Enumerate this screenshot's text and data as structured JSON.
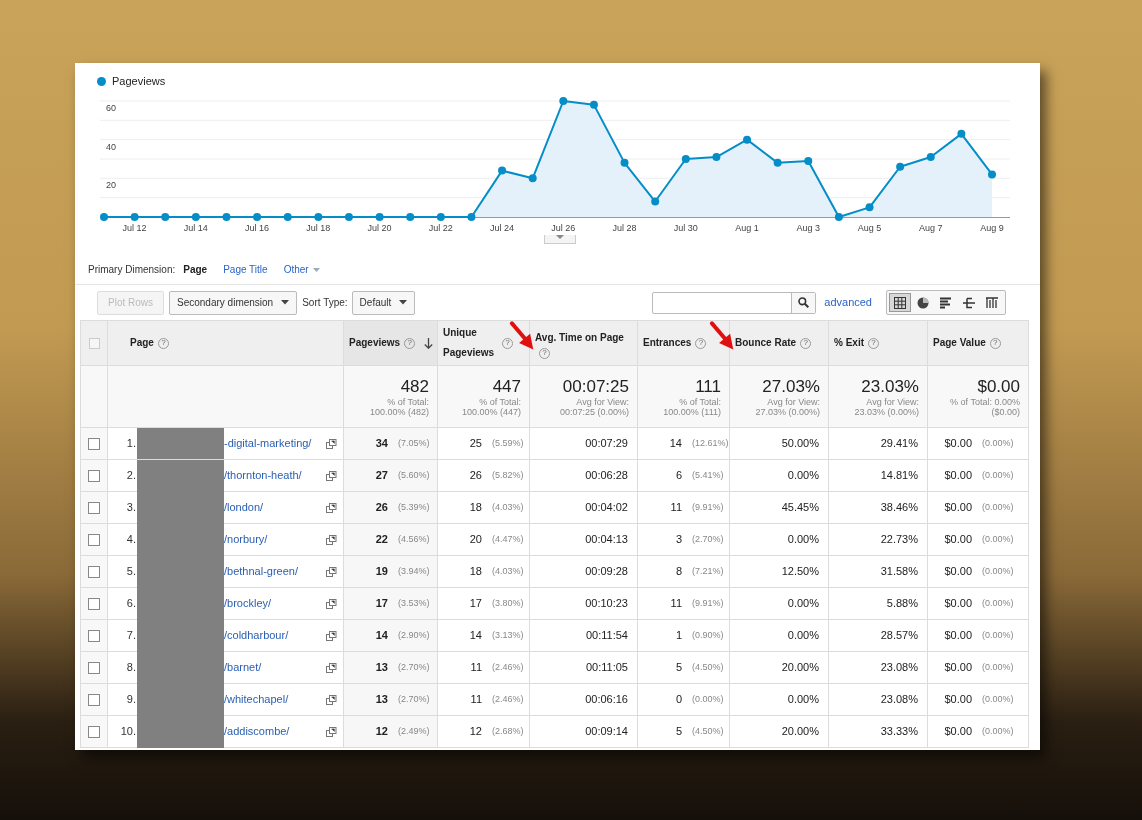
{
  "chart": {
    "chart_data": {
      "type": "area",
      "categories": [
        null,
        "Jul 12",
        null,
        "Jul 14",
        null,
        "Jul 16",
        null,
        "Jul 18",
        null,
        "Jul 20",
        null,
        "Jul 22",
        null,
        "Jul 24",
        null,
        "Jul 26",
        null,
        "Jul 28",
        null,
        "Jul 30",
        null,
        "Aug 1",
        null,
        "Aug 3",
        null,
        "Aug 5",
        null,
        "Aug 7",
        null,
        "Aug 9"
      ],
      "series": [
        {
          "name": "Pageviews",
          "color": "#058dc7",
          "values": [
            0,
            0,
            0,
            0,
            0,
            0,
            0,
            0,
            0,
            0,
            0,
            0,
            0,
            24,
            20,
            60,
            58,
            28,
            8,
            30,
            31,
            40,
            28,
            29,
            0,
            5,
            26,
            31,
            43,
            22
          ]
        }
      ],
      "ylim": [
        0,
        60
      ],
      "yticks": [
        20,
        40,
        60
      ],
      "grid": true
    }
  },
  "primary_dimension": {
    "label": "Primary Dimension:",
    "options": [
      {
        "label": "Page",
        "selected": true
      },
      {
        "label": "Page Title",
        "selected": false
      },
      {
        "label": "Other",
        "selected": false,
        "dropdown": true
      }
    ]
  },
  "toolbar": {
    "plot_rows": {
      "label": "Plot Rows",
      "disabled": true
    },
    "secondary_dimension": "Secondary dimension",
    "sort_type_label": "Sort Type:",
    "sort_type": "Default",
    "advanced": "advanced",
    "views": [
      {
        "kind": "grid",
        "selected": true
      },
      {
        "kind": "pie",
        "selected": false
      },
      {
        "kind": "bars",
        "selected": false
      },
      {
        "kind": "compare",
        "selected": false
      },
      {
        "kind": "pivot",
        "selected": false
      }
    ]
  },
  "table": {
    "select_all_checked": false,
    "columns": [
      {
        "label": "Page",
        "help": "?",
        "sorted": false,
        "marked": false
      },
      {
        "label": "Pageviews",
        "help": "?",
        "sorted": true,
        "marked": false
      },
      {
        "label": "Unique Pageviews",
        "help": "?",
        "sorted": false,
        "marked": false
      },
      {
        "label": "Avg. Time on Page",
        "help": "?",
        "sorted": false,
        "marked": true
      },
      {
        "label": "Entrances",
        "help": "?",
        "sorted": false,
        "marked": false
      },
      {
        "label": "Bounce Rate",
        "help": "?",
        "sorted": false,
        "marked": true
      },
      {
        "label": "% Exit",
        "help": "?",
        "sorted": false,
        "marked": false
      },
      {
        "label": "Page Value",
        "help": "?",
        "sorted": false,
        "marked": false
      }
    ],
    "totals": [
      {
        "value": "482",
        "lines": [
          "% of Total:",
          "100.00% (482)"
        ]
      },
      {
        "value": "447",
        "lines": [
          "% of Total:",
          "100.00% (447)"
        ]
      },
      {
        "value": "00:07:25",
        "lines": [
          "Avg for View:",
          "00:07:25 (0.00%)"
        ]
      },
      {
        "value": "111",
        "lines": [
          "% of Total:",
          "100.00% (111)"
        ]
      },
      {
        "value": "27.03%",
        "lines": [
          "Avg for View:",
          "27.03% (0.00%)"
        ]
      },
      {
        "value": "23.03%",
        "lines": [
          "Avg for View:",
          "23.03% (0.00%)"
        ]
      },
      {
        "value": "$0.00",
        "lines": [
          "% of Total: 0.00%",
          "($0.00)"
        ]
      }
    ],
    "rows": [
      {
        "checked": false,
        "cells": [
          {
            "rank": "1.",
            "page": "-digital-marketing/"
          },
          {
            "value": "34",
            "pct": "(7.05%)"
          },
          {
            "value": "25",
            "pct": "(5.59%)"
          },
          {
            "value": "00:07:29"
          },
          {
            "value": "14",
            "pct": "(12.61%)"
          },
          {
            "value": "50.00%"
          },
          {
            "value": "29.41%"
          },
          {
            "value": "$0.00",
            "pct": "(0.00%)"
          }
        ]
      },
      {
        "checked": false,
        "cells": [
          {
            "rank": "2.",
            "page": "/thornton-heath/"
          },
          {
            "value": "27",
            "pct": "(5.60%)"
          },
          {
            "value": "26",
            "pct": "(5.82%)"
          },
          {
            "value": "00:06:28"
          },
          {
            "value": "6",
            "pct": "(5.41%)"
          },
          {
            "value": "0.00%"
          },
          {
            "value": "14.81%"
          },
          {
            "value": "$0.00",
            "pct": "(0.00%)"
          }
        ]
      },
      {
        "checked": false,
        "cells": [
          {
            "rank": "3.",
            "page": "/london/"
          },
          {
            "value": "26",
            "pct": "(5.39%)"
          },
          {
            "value": "18",
            "pct": "(4.03%)"
          },
          {
            "value": "00:04:02"
          },
          {
            "value": "11",
            "pct": "(9.91%)"
          },
          {
            "value": "45.45%"
          },
          {
            "value": "38.46%"
          },
          {
            "value": "$0.00",
            "pct": "(0.00%)"
          }
        ]
      },
      {
        "checked": false,
        "cells": [
          {
            "rank": "4.",
            "page": "/norbury/"
          },
          {
            "value": "22",
            "pct": "(4.56%)"
          },
          {
            "value": "20",
            "pct": "(4.47%)"
          },
          {
            "value": "00:04:13"
          },
          {
            "value": "3",
            "pct": "(2.70%)"
          },
          {
            "value": "0.00%"
          },
          {
            "value": "22.73%"
          },
          {
            "value": "$0.00",
            "pct": "(0.00%)"
          }
        ]
      },
      {
        "checked": false,
        "cells": [
          {
            "rank": "5.",
            "page": "/bethnal-green/"
          },
          {
            "value": "19",
            "pct": "(3.94%)"
          },
          {
            "value": "18",
            "pct": "(4.03%)"
          },
          {
            "value": "00:09:28"
          },
          {
            "value": "8",
            "pct": "(7.21%)"
          },
          {
            "value": "12.50%"
          },
          {
            "value": "31.58%"
          },
          {
            "value": "$0.00",
            "pct": "(0.00%)"
          }
        ]
      },
      {
        "checked": false,
        "cells": [
          {
            "rank": "6.",
            "page": "/brockley/"
          },
          {
            "value": "17",
            "pct": "(3.53%)"
          },
          {
            "value": "17",
            "pct": "(3.80%)"
          },
          {
            "value": "00:10:23"
          },
          {
            "value": "11",
            "pct": "(9.91%)"
          },
          {
            "value": "0.00%"
          },
          {
            "value": "5.88%"
          },
          {
            "value": "$0.00",
            "pct": "(0.00%)"
          }
        ]
      },
      {
        "checked": false,
        "cells": [
          {
            "rank": "7.",
            "page": "/coldharbour/"
          },
          {
            "value": "14",
            "pct": "(2.90%)"
          },
          {
            "value": "14",
            "pct": "(3.13%)"
          },
          {
            "value": "00:11:54"
          },
          {
            "value": "1",
            "pct": "(0.90%)"
          },
          {
            "value": "0.00%"
          },
          {
            "value": "28.57%"
          },
          {
            "value": "$0.00",
            "pct": "(0.00%)"
          }
        ]
      },
      {
        "checked": false,
        "cells": [
          {
            "rank": "8.",
            "page": "/barnet/"
          },
          {
            "value": "13",
            "pct": "(2.70%)"
          },
          {
            "value": "11",
            "pct": "(2.46%)"
          },
          {
            "value": "00:11:05"
          },
          {
            "value": "5",
            "pct": "(4.50%)"
          },
          {
            "value": "20.00%"
          },
          {
            "value": "23.08%"
          },
          {
            "value": "$0.00",
            "pct": "(0.00%)"
          }
        ]
      },
      {
        "checked": false,
        "cells": [
          {
            "rank": "9.",
            "page": "/whitechapel/"
          },
          {
            "value": "13",
            "pct": "(2.70%)"
          },
          {
            "value": "11",
            "pct": "(2.46%)"
          },
          {
            "value": "00:06:16"
          },
          {
            "value": "0",
            "pct": "(0.00%)"
          },
          {
            "value": "0.00%"
          },
          {
            "value": "23.08%"
          },
          {
            "value": "$0.00",
            "pct": "(0.00%)"
          }
        ]
      },
      {
        "checked": false,
        "cells": [
          {
            "rank": "10.",
            "page": "/addiscombe/"
          },
          {
            "value": "12",
            "pct": "(2.49%)"
          },
          {
            "value": "12",
            "pct": "(2.68%)"
          },
          {
            "value": "00:09:14"
          },
          {
            "value": "5",
            "pct": "(4.50%)"
          },
          {
            "value": "20.00%"
          },
          {
            "value": "33.33%"
          },
          {
            "value": "$0.00",
            "pct": "(0.00%)"
          }
        ]
      }
    ]
  }
}
